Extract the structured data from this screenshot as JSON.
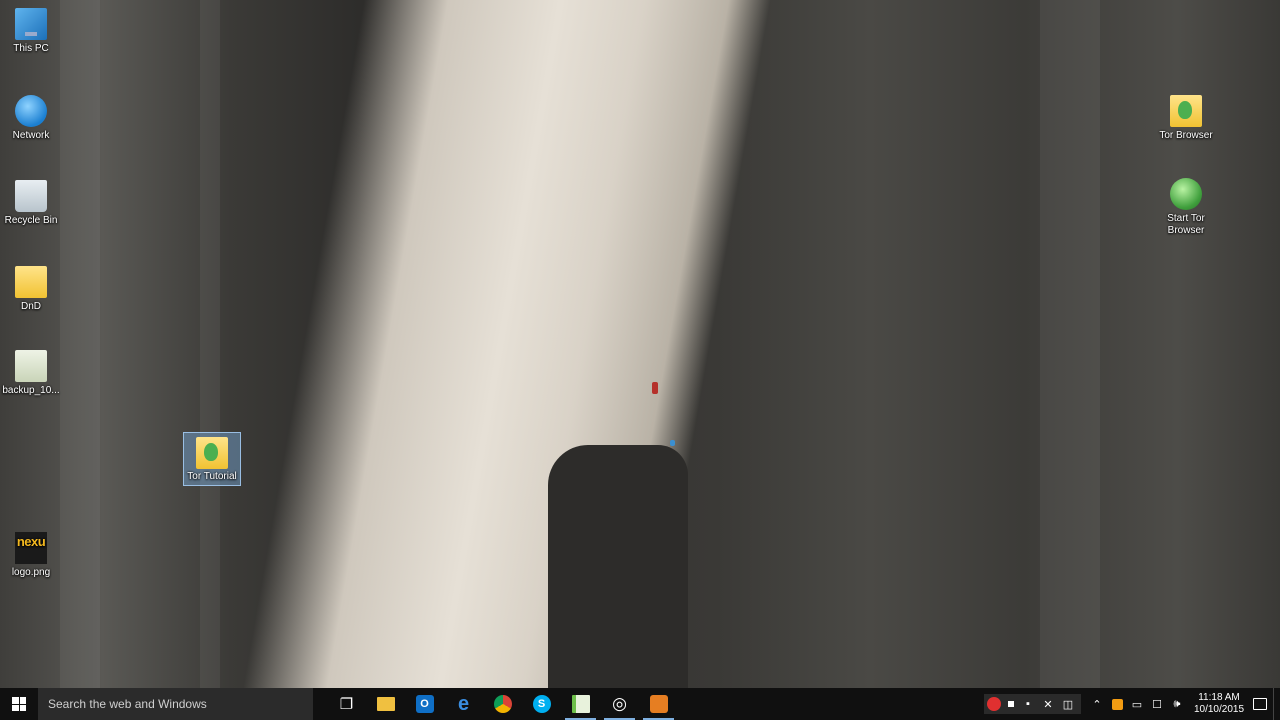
{
  "desktop": {
    "icons_left": [
      {
        "id": "this-pc",
        "label": "This PC",
        "icon": "this-pc-icon"
      },
      {
        "id": "network",
        "label": "Network",
        "icon": "network-icon"
      },
      {
        "id": "recycle-bin",
        "label": "Recycle Bin",
        "icon": "recycle-bin-icon"
      },
      {
        "id": "dnd",
        "label": "DnD",
        "icon": "folder-icon"
      },
      {
        "id": "backup",
        "label": "backup_10...",
        "icon": "file-icon"
      },
      {
        "id": "logo",
        "label": "logo.png",
        "icon": "image-icon",
        "logo_text": "nexu"
      }
    ],
    "selected_icon": {
      "id": "tor-tutorial",
      "label": "Tor Tutorial",
      "icon": "tor-folder-icon"
    },
    "icons_right": [
      {
        "id": "tor-browser",
        "label": "Tor Browser",
        "icon": "tor-folder-icon"
      },
      {
        "id": "start-tor-browser",
        "label": "Start Tor Browser",
        "icon": "tor-globe-icon"
      }
    ]
  },
  "taskbar": {
    "search_placeholder": "Search the web and Windows",
    "apps": [
      {
        "id": "task-view",
        "icon": "task-view-icon",
        "glyph": "❐",
        "color": "transparent",
        "running": false
      },
      {
        "id": "file-explorer",
        "icon": "folder-icon",
        "glyph": "",
        "color": "#f0c040",
        "running": false
      },
      {
        "id": "outlook",
        "icon": "outlook-icon",
        "glyph": "O",
        "color": "#0f6fc6",
        "running": false
      },
      {
        "id": "edge",
        "icon": "edge-icon",
        "glyph": "e",
        "color": "transparent",
        "running": false
      },
      {
        "id": "chrome",
        "icon": "chrome-icon",
        "glyph": "",
        "color": "#db4437",
        "running": false
      },
      {
        "id": "skype",
        "icon": "skype-icon",
        "glyph": "S",
        "color": "#00aff0",
        "running": false
      },
      {
        "id": "notepad-plus",
        "icon": "document-icon",
        "glyph": "",
        "color": "#6dbf4a",
        "running": true
      },
      {
        "id": "media-player",
        "icon": "media-player-icon",
        "glyph": "◎",
        "color": "transparent",
        "running": true
      },
      {
        "id": "app-orange",
        "icon": "app-icon",
        "glyph": "",
        "color": "#e67e22",
        "running": true
      }
    ],
    "clock": {
      "time": "11:18 AM",
      "date": "10/10/2015"
    }
  }
}
